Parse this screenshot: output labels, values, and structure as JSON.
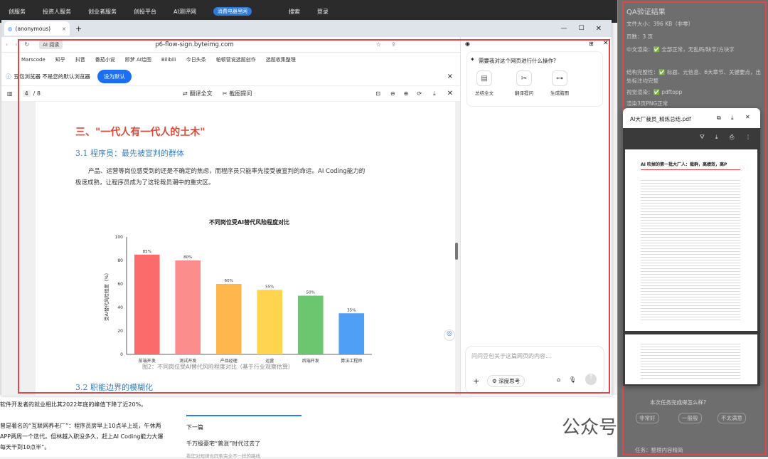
{
  "bg": {
    "nav": [
      "创服务",
      "投资人服务",
      "创业者服务",
      "创投平台",
      "AI测评网",
      "消费电器里网",
      "搜索",
      "登录"
    ],
    "article_lines": [
      "软件开发者的就业相比其2022年底的峰值下降了近20%。",
      "曾是著名的“互联网养老厂”：程序员房早上10点半上班，午休两",
      "APP两周一个迭代。但林越入职没多久，赶上AI Coding能力大爆",
      "每天干到10点半”。"
    ],
    "next_title": "下一篇",
    "next_item": "千万级豪宅“普涨”时代过去了",
    "next_sub": "看您对规律也同条完全不一样的路线",
    "watermark": "公众号 · 鲸选AI"
  },
  "right": {
    "title": "QA验证结果",
    "lines": [
      "文件大小：396 KB（非零）",
      "页数：3 页",
      "中文渲染：✅ 全部正常，无乱码/缺字/方块字",
      "结构完整性：✅ 标题、元信息、6大章节、关键要点，出处标注均完整",
      "视觉渲染：✅ pdftopp",
      "渲染3页PNG正常"
    ],
    "question": "本次任务完成得怎么样?",
    "opts": [
      "非常好",
      "一般般",
      "不太满意"
    ],
    "task": "任务：整理内容精简"
  },
  "browser": {
    "tab": "(anonymous)",
    "url": "p6-flow-sign.byteimg.com",
    "pill": "AI 阅读",
    "bookmarks": [
      "Marscode",
      "知乎",
      "抖音",
      "番茄小说",
      "即梦 AI绘图",
      "Bilibili",
      "今日头条",
      "帕顿营说选题创作",
      "选题收集整理"
    ],
    "info": "豆包浏览器 不是您的默认浏览器",
    "set_default": "设为默认",
    "page": "4",
    "pages": "/ 8",
    "translate": "翻译全文",
    "screenshot": "截图提问"
  },
  "doc": {
    "h2": "三、\"一代人有一代人的土木\"",
    "h3": "3.1 程序员：最先被宣判的群体",
    "para": "产品、运营等岗位感受到的还是不确定的焦虑，而程序员只能率先接受被宣判的命运。AI Coding能力的极速成熟，让程序员成为了这轮裁员潮中的重灾区。",
    "caption": "图2：不同岗位受AI替代风险程度对比（基于行业观察估算）",
    "h3b": "3.2 职能边界的模糊化"
  },
  "ai": {
    "prompt": "需要我对这个网页进行什么操作?",
    "actions": [
      "总结全文",
      "翻译提问",
      "生成脑图"
    ],
    "input_placeholder": "问问豆包关于这篇网页的内容...",
    "deep": "深度思考"
  },
  "pdf": {
    "title": "AI大厂裁员_精炼总结.pdf",
    "heading": "AI 吹掉的第一批大厂人：裁群，高绩效，高P"
  },
  "colors": {
    "red": "#e0474b",
    "blue": "#1c6ef2"
  },
  "chart_data": {
    "type": "bar",
    "title": "不同岗位受AI替代风险程度对比",
    "ylabel": "受AI替代风险程度（%）",
    "categories": [
      "前端开发",
      "测试开发",
      "产品经理",
      "运营",
      "后端开发",
      "算法工程师"
    ],
    "values": [
      85,
      80,
      60,
      55,
      50,
      35
    ],
    "labels": [
      "85%",
      "80%",
      "60%",
      "55%",
      "50%",
      "35%"
    ],
    "ylim": [
      0,
      100
    ],
    "yticks": [
      0,
      20,
      40,
      60,
      80,
      100
    ],
    "colors": [
      "#fb6b6b",
      "#fc8d8d",
      "#ffb74d",
      "#ffd54f",
      "#6cc66f",
      "#4e9ff5"
    ]
  }
}
